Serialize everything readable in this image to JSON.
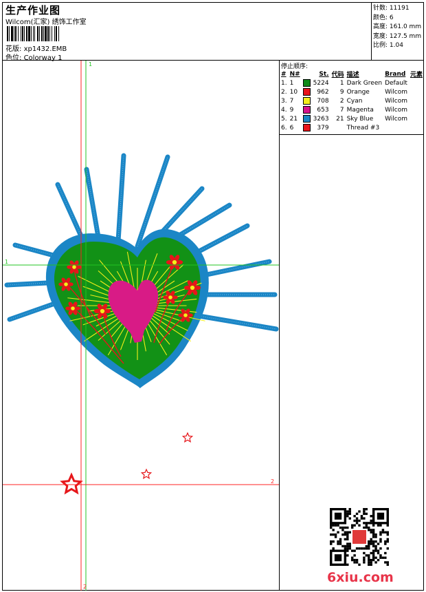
{
  "header": {
    "title": "生产作业图",
    "subtitle": "Wilcom(汇家) 绣饰工作室",
    "design_label": "花版:",
    "design_value": "xp1432.EMB",
    "colorway_label": "色位:",
    "colorway_value": "Colorway 1"
  },
  "stats": [
    {
      "label": "针数:",
      "value": "11191"
    },
    {
      "label": "颜色:",
      "value": "6"
    },
    {
      "label": "高度:",
      "value": "161.0 mm"
    },
    {
      "label": "宽度:",
      "value": "127.5 mm"
    },
    {
      "label": "比例:",
      "value": "1.04"
    }
  ],
  "stop_sequence": {
    "title": "停止顺序:",
    "columns": [
      "#",
      "N#",
      "St.",
      "代码",
      "描述",
      "Brand",
      "元素"
    ],
    "rows": [
      {
        "seq": "1.",
        "n": "1",
        "color": "#0f8a19",
        "st": "5224",
        "code": "1",
        "desc": "Dark Green",
        "brand": "Default"
      },
      {
        "seq": "2.",
        "n": "10",
        "color": "#e8141a",
        "st": "962",
        "code": "9",
        "desc": "Orange",
        "brand": "Wilcom"
      },
      {
        "seq": "3.",
        "n": "7",
        "color": "#f5ef1e",
        "st": "708",
        "code": "2",
        "desc": "Cyan",
        "brand": "Wilcom"
      },
      {
        "seq": "4.",
        "n": "9",
        "color": "#d6148c",
        "st": "653",
        "code": "7",
        "desc": "Magenta",
        "brand": "Wilcom"
      },
      {
        "seq": "5.",
        "n": "21",
        "color": "#1a86c4",
        "st": "3263",
        "code": "21",
        "desc": "Sky Blue",
        "brand": "Wilcom"
      },
      {
        "seq": "6.",
        "n": "6",
        "color": "#e8141a",
        "st": "379",
        "code": "",
        "desc": "Thread #3",
        "brand": ""
      }
    ]
  },
  "guides": {
    "h1_label": "1",
    "h2_label": "2",
    "v1_label": "1",
    "v2_label": "2"
  },
  "colors": {
    "green": "#129116",
    "blue": "#1b86c6",
    "magenta": "#d81b86",
    "red": "#e6161a",
    "yellow": "#f3ee1a",
    "guide_green": "#21c421",
    "guide_red": "#ff2020"
  },
  "watermark": "6xiu.com"
}
